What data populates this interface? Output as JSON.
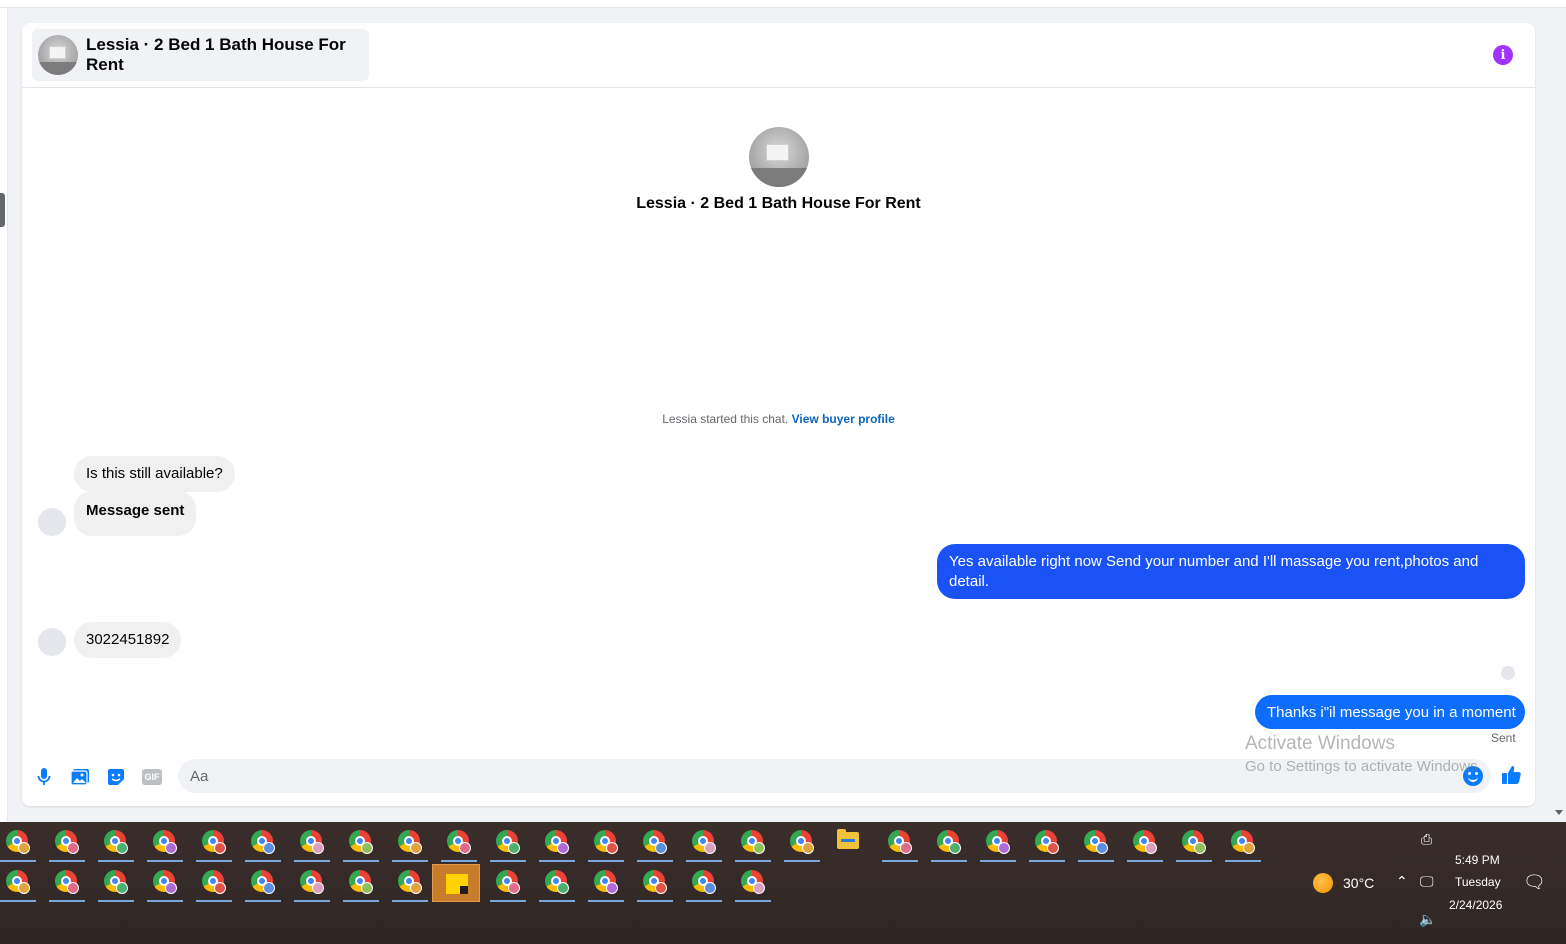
{
  "chat": {
    "title": "Lessia · 2 Bed 1 Bath House For Rent",
    "intro_title": "Lessia · 2 Bed 1 Bath House For Rent",
    "started_text": "Lessia started this chat.",
    "buyer_profile_link": "View buyer profile"
  },
  "messages": [
    {
      "direction": "in",
      "text": "Is this still available?"
    },
    {
      "direction": "in",
      "text": "Message sent"
    },
    {
      "direction": "out",
      "text": "Yes available right now Send your number and I'll massage you rent,photos and detail."
    },
    {
      "direction": "in",
      "text": "3022451892"
    },
    {
      "direction": "out",
      "text": "Thanks i\"il message you in a moment"
    }
  ],
  "message_status": "Sent",
  "composer": {
    "placeholder": "Aa",
    "icons": [
      "microphone-icon",
      "photo-icon",
      "sticker-icon",
      "gif-icon",
      "emoji-icon",
      "like-icon"
    ],
    "gif_label": "GIF"
  },
  "watermark": {
    "line1": "Activate Windows",
    "line2": "Go to Settings to activate Windows."
  },
  "taskbar": {
    "temperature": "30°C",
    "time": "5:49 PM",
    "day": "Tuesday",
    "date": "2/24/2026"
  },
  "colors": {
    "outgoing_bubble_primary": "#1a52f5",
    "outgoing_bubble_secondary": "#0d6efd",
    "incoming_bubble": "#f0f0f0",
    "link": "#0a66c2",
    "info_icon": "#a033ff",
    "taskbar_bg": "#362b28"
  }
}
